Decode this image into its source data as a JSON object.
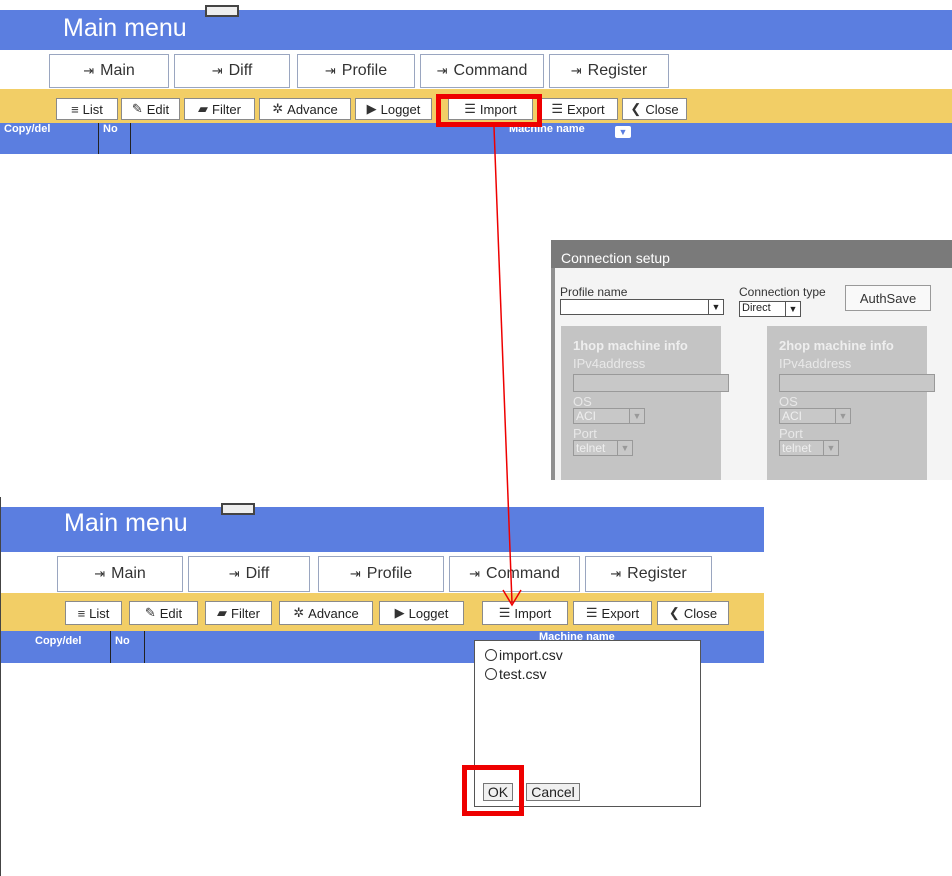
{
  "title": "Main menu",
  "tabs": [
    "Main",
    "Diff",
    "Profile",
    "Command",
    "Register"
  ],
  "toolbar": [
    "List",
    "Edit",
    "Filter",
    "Advance",
    "Logget",
    "Import",
    "Export",
    "Close"
  ],
  "header": {
    "copydel": "Copy/del",
    "no": "No",
    "machine_name": "Machine name"
  },
  "dialog": {
    "title": "Connection setup",
    "profile_label": "Profile name",
    "connection_type_label": "Connection type",
    "connection_type_value": "Direct",
    "authsave": "AuthSave",
    "hop1": {
      "title": "1hop machine info",
      "ip_label": "IPv4address",
      "os_label": "OS",
      "os_value": "ACI",
      "port_label": "Port",
      "port_value": "telnet"
    },
    "hop2": {
      "title": "2hop machine info",
      "ip_label": "IPv4address",
      "os_label": "OS",
      "os_value": "ACI",
      "port_label": "Port",
      "port_value": "telnet"
    }
  },
  "popup": {
    "files": [
      "import.csv",
      "test.csv"
    ],
    "ok": "OK",
    "cancel": "Cancel"
  },
  "colors": {
    "blue": "#5b7ee0",
    "yellow": "#f2ce66",
    "highlight": "#ee0000"
  }
}
